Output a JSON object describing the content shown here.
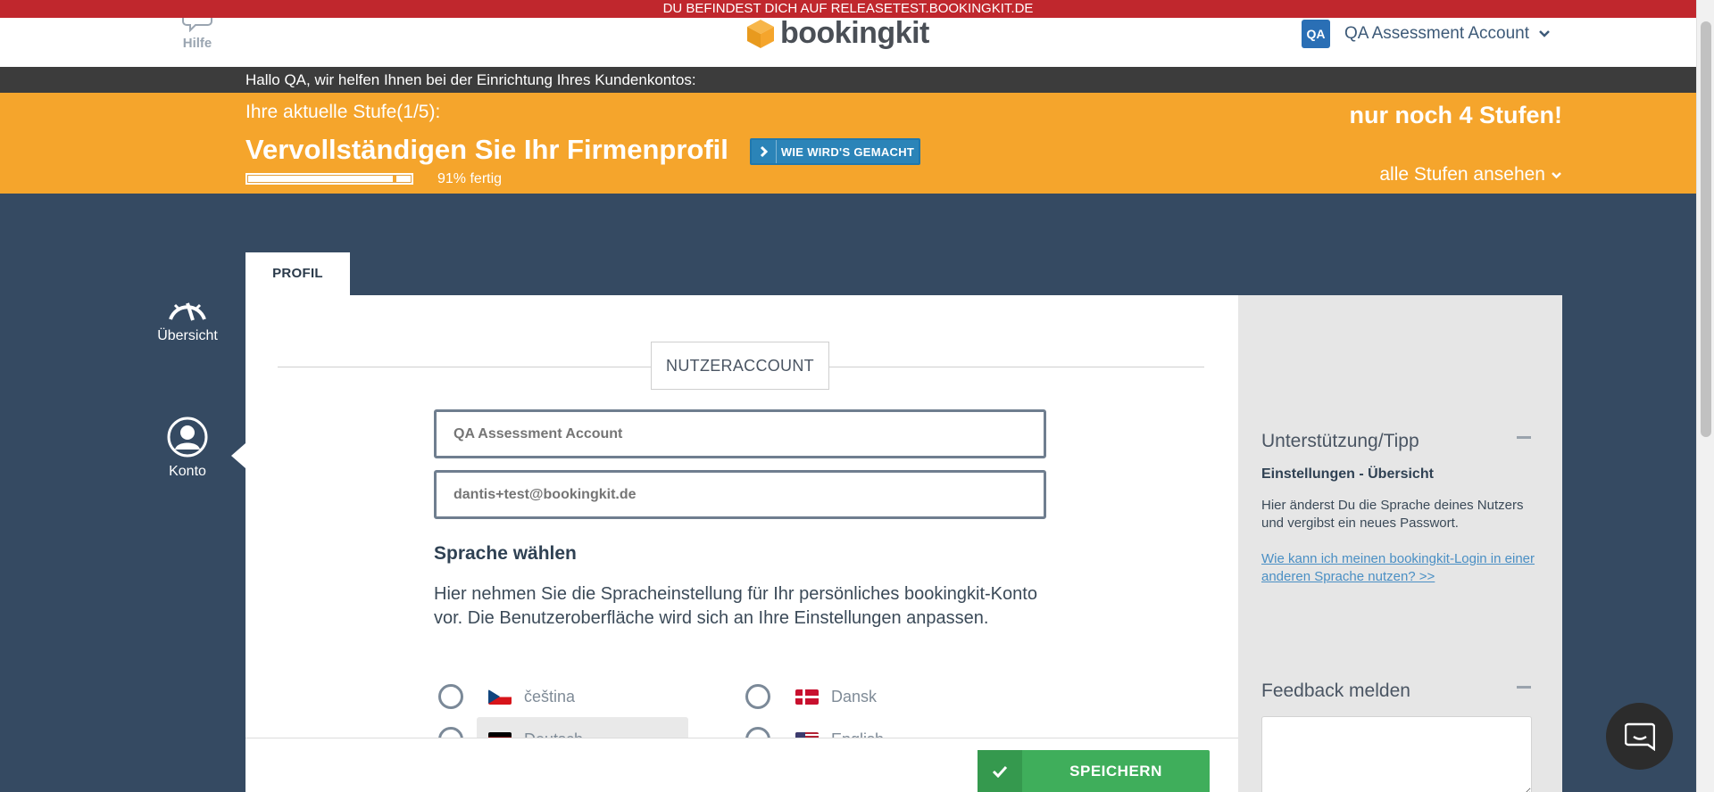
{
  "env_banner": "DU BEFINDEST DICH AUF RELEASETEST.BOOKINGKIT.DE",
  "header": {
    "help_label": "Hilfe",
    "logo_text": "bookingkit",
    "account_initials": "QA",
    "account_name": "QA Assessment Account"
  },
  "welcome": "Hallo QA, wir helfen Ihnen bei der Einrichtung Ihres Kundenkontos:",
  "onboarding": {
    "stage_label": "Ihre aktuelle Stufe(1/5):",
    "stage_title": "Vervollständigen Sie Ihr Firmenprofil",
    "how_button": "WIE WIRD'S GEMACHT",
    "progress_percent": 91,
    "progress_text": "91% fertig",
    "remaining": "nur noch 4 Stufen!",
    "all_stages": "alle Stufen ansehen"
  },
  "sidenav": {
    "overview": "Übersicht",
    "account": "Konto"
  },
  "tabs": {
    "profile": "PROFIL"
  },
  "form": {
    "section_title": "NUTZERACCOUNT",
    "name_placeholder": "QA Assessment Account",
    "email_placeholder": "dantis+test@bookingkit.de",
    "lang_heading": "Sprache wählen",
    "lang_description": "Hier nehmen Sie die Spracheinstellung für Ihr persönliches bookingkit-Konto vor. Die Benutzeroberfläche wird sich an Ihre Einstellungen anpassen.",
    "languages": [
      {
        "label": "čeština",
        "flag": "cz-flag"
      },
      {
        "label": "Dansk",
        "flag": "dk-flag"
      },
      {
        "label": "Deutsch",
        "flag": "de-flag"
      },
      {
        "label": "English",
        "flag": "us-flag"
      }
    ],
    "save_label": "SPEICHERN"
  },
  "side_panel": {
    "support_title": "Unterstützung/Tipp",
    "support_subtitle": "Einstellungen - Übersicht",
    "support_text": "Hier änderst Du die Sprache deines Nutzers und vergibst ein neues Passwort.",
    "support_link": "Wie kann ich meinen bookingkit-Login in einer anderen Sprache nutzen? >>",
    "feedback_title": "Feedback melden"
  },
  "colors": {
    "env_banner": "#c0272d",
    "onboarding": "#f5a52c",
    "nav_bg": "#354a62",
    "save": "#3fae5b",
    "link": "#4a8fc4"
  }
}
